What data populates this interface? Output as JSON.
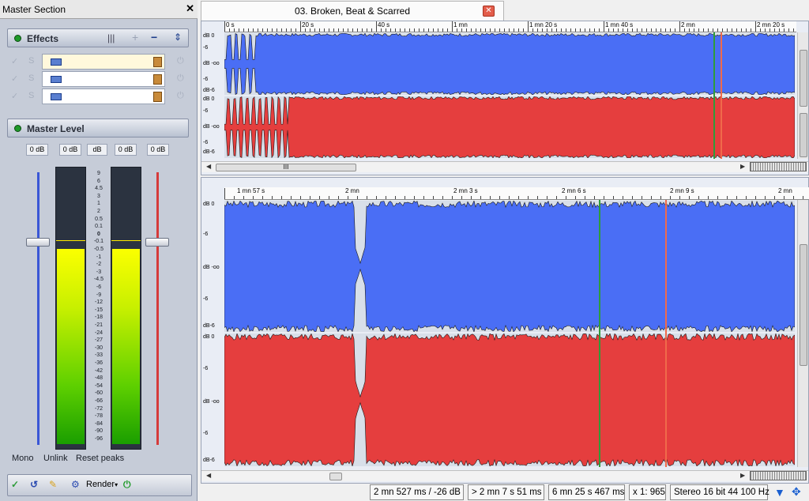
{
  "master": {
    "title": "Master Section",
    "close_glyph": "✕",
    "effects": {
      "title": "Effects"
    },
    "fx_slots": [
      {
        "selected": true
      },
      {
        "selected": false
      },
      {
        "selected": false
      }
    ],
    "master_level": {
      "title": "Master Level"
    },
    "db_readouts": [
      "0 dB",
      "0 dB",
      "dB",
      "0 dB",
      "0 dB"
    ],
    "scale": [
      "9",
      "6",
      "4.5",
      "3",
      "1",
      "2",
      "0.5",
      "0.1",
      "0",
      "-0.1",
      "-0.5",
      "-1",
      "-2",
      "-3",
      "-4.5",
      "-6",
      "-9",
      "-12",
      "-15",
      "-18",
      "-21",
      "-24",
      "-27",
      "-30",
      "-33",
      "-36",
      "-42",
      "-48",
      "-54",
      "-60",
      "-66",
      "-72",
      "-78",
      "-84",
      "-90",
      "-96"
    ],
    "left_meter_level": 0.71,
    "right_meter_level": 0.71,
    "left_fader_level": 0.24,
    "right_fader_level": 0.24,
    "buttons": {
      "mono": "Mono",
      "unlink": "Unlink",
      "reset": "Reset peaks",
      "render": "Render"
    },
    "colors": {
      "left_fader": "#3a57d6",
      "right_fader": "#d63a3a"
    }
  },
  "editor": {
    "tab_title": "03. Broken, Beat & Scarred",
    "tab_close": "✕",
    "overview_ruler": [
      "0 s",
      "20 s",
      "40 s",
      "1 mn",
      "1 mn 20 s",
      "1 mn 40 s",
      "2 mn",
      "2 mn 20 s"
    ],
    "detail_ruler": [
      "1 mn 57 s",
      "2 mn",
      "2 mn 3 s",
      "2 mn 6 s",
      "2 mn 9 s",
      "2 mn"
    ],
    "db_labels": [
      "dB 0",
      "-6",
      "dB -oo",
      "-6",
      "dB-6"
    ],
    "hscroll_grip": "III",
    "colors": {
      "left_channel": "#4a6ef5",
      "right_channel": "#e53e3e",
      "play_cursor": "#2e9c3a",
      "edit_cursor": "#f06a4a"
    }
  },
  "status": {
    "cursor": "2 mn 527 ms / -26 dB",
    "selection": "> 2 mn 7 s 51 ms",
    "length": "6 mn 25 s 467 ms",
    "zoom": "x 1: 965",
    "format": "Stereo 16 bit 44 100 Hz"
  }
}
